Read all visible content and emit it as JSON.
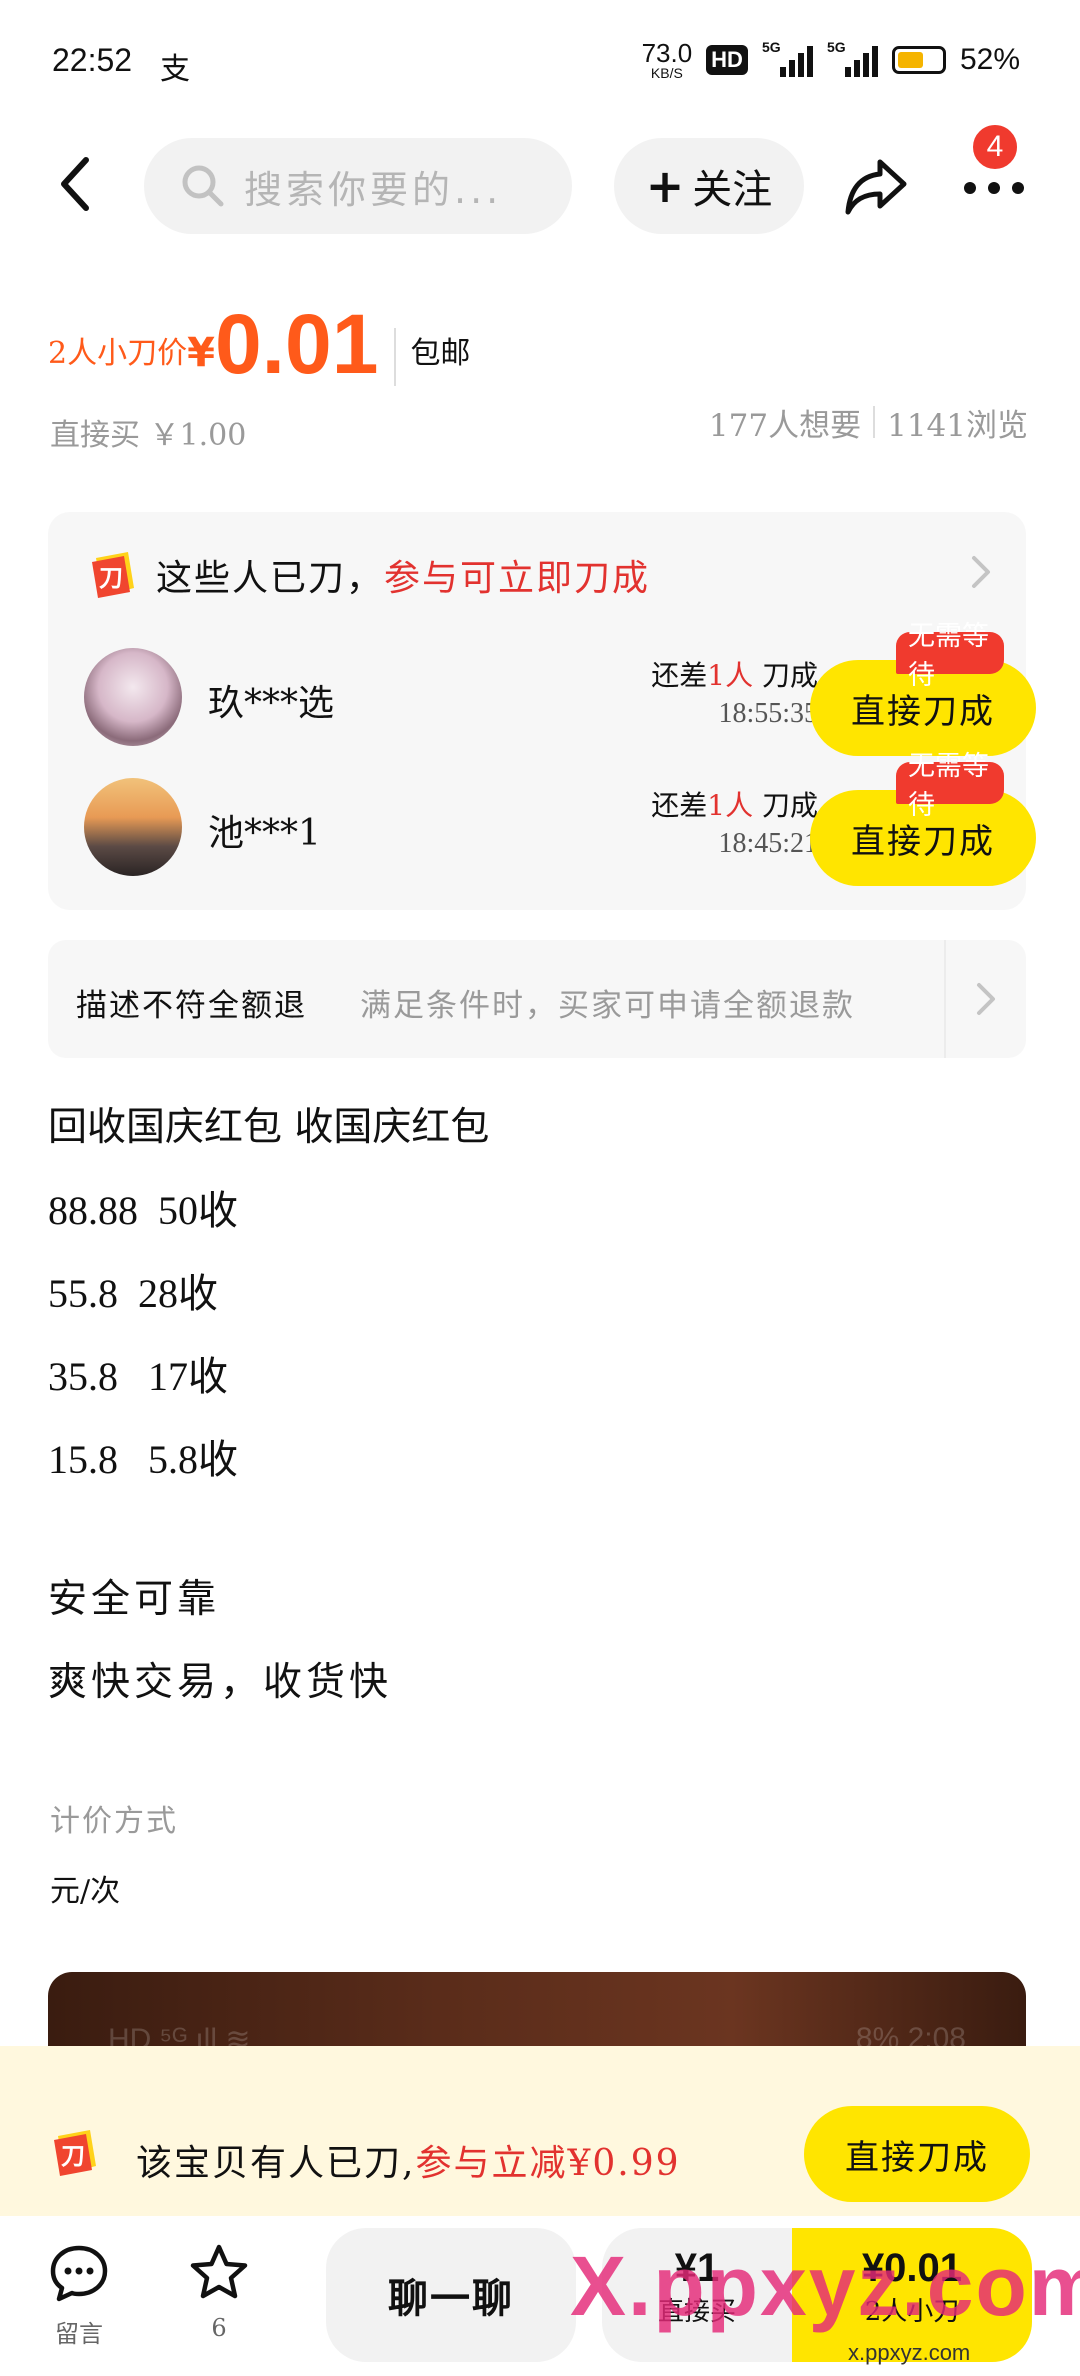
{
  "status_bar": {
    "time": "22:52",
    "alipay_glyph": "支",
    "net_speed": "73.0",
    "net_unit": "KB/S",
    "hd": "HD",
    "sim1": "5G",
    "sim2": "5G",
    "battery_pct": "52%",
    "battery_level": 0.52,
    "battery_color": "#f5b400"
  },
  "nav": {
    "search_placeholder": "搜索你要的...",
    "follow_label": "关注",
    "notification_count": "4"
  },
  "price": {
    "label": "2人小刀价",
    "symbol": "¥",
    "value": "0.01",
    "shipping": "包邮",
    "direct_buy": "直接买 ￥1.00",
    "wants": "177人想要",
    "views": "1141浏览",
    "accent_color": "#ff5a1a"
  },
  "bargain": {
    "title_prefix": "这些人已刀，",
    "title_highlight": "参与可立即刀成",
    "rows": [
      {
        "name": "玖***选",
        "need_prefix": "还差",
        "need_count": "1人",
        "need_suffix": "刀成",
        "timer": "18:55:35",
        "button": "直接刀成",
        "tag": "无需等待"
      },
      {
        "name": "池***1",
        "need_prefix": "还差",
        "need_count": "1人",
        "need_suffix": "刀成",
        "timer": "18:45:21",
        "button": "直接刀成",
        "tag": "无需等待"
      }
    ]
  },
  "guarantee": {
    "title": "描述不符全额退",
    "desc": "满足条件时，买家可申请全额退款"
  },
  "description": {
    "lines": [
      "回收国庆红包 收国庆红包",
      "88.88  50收",
      "55.8  28收",
      "35.8   17收",
      "15.8   5.8收"
    ],
    "lines2": [
      "安全可靠",
      "爽快交易，收货快"
    ]
  },
  "pricing": {
    "label": "计价方式",
    "value": "元/次"
  },
  "preview_overlay": {
    "left": "HD ⁵ᴳ ıll ≋",
    "right": "8%  2:08"
  },
  "banner": {
    "text_prefix": "该宝贝有人已刀,",
    "text_highlight": "参与立减¥0.99",
    "button": "直接刀成"
  },
  "bottom_bar": {
    "message_label": "留言",
    "favorite_count": "6",
    "chat_label": "聊一聊",
    "buy_price": "¥1",
    "buy_label": "直接买",
    "cut_price": "¥0.01",
    "cut_label": "2人小刀"
  },
  "watermark": {
    "main": "X.ppxyz.com",
    "sub": "x.ppxyz.com"
  },
  "colors": {
    "yellow": "#ffe500",
    "red": "#e2322f",
    "badge_red": "#f03a2e",
    "banner_bg": "#fff8de"
  }
}
